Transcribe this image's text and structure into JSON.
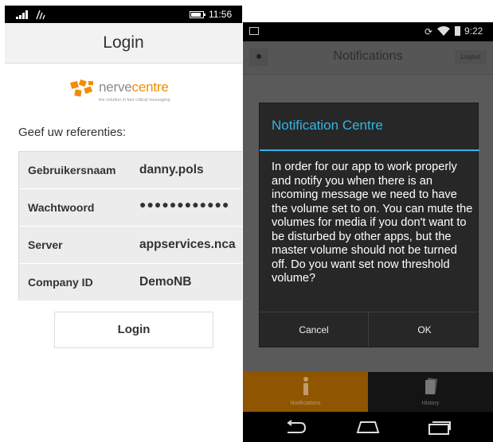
{
  "left_phone": {
    "status": {
      "time": "11:56"
    },
    "header_title": "Login",
    "logo": {
      "brand_part1": "nerve",
      "brand_part2": "centre",
      "tagline": "the solution in fast critical messaging"
    },
    "credentials_heading": "Geef uw referenties:",
    "fields": [
      {
        "label": "Gebruikersnaam",
        "value": "danny.pols"
      },
      {
        "label": "Wachtwoord",
        "value": "●●●●●●●●●●●●"
      },
      {
        "label": "Server",
        "value": "appservices.nca"
      },
      {
        "label": "Company ID",
        "value": "DemoNB"
      }
    ],
    "login_button": "Login"
  },
  "right_phone": {
    "status": {
      "time": "9:22"
    },
    "header": {
      "title": "Notifications",
      "logout": "Logout"
    },
    "dialog": {
      "title": "Notification Centre",
      "message": "In order for our app to work properly and notify you when there is an incoming message we need to have the volume set to on. You can mute the volumes for media if you don't want to be disturbed by other apps, but the master volume should not be turned off. Do you want set now threshold volume?",
      "cancel": "Cancel",
      "ok": "OK"
    },
    "tabs": [
      {
        "label": "Notifications"
      },
      {
        "label": "History"
      }
    ]
  },
  "colors": {
    "accent_blue": "#33b5e5",
    "brand_orange": "#f28c00",
    "active_tab": "#8f5500"
  }
}
